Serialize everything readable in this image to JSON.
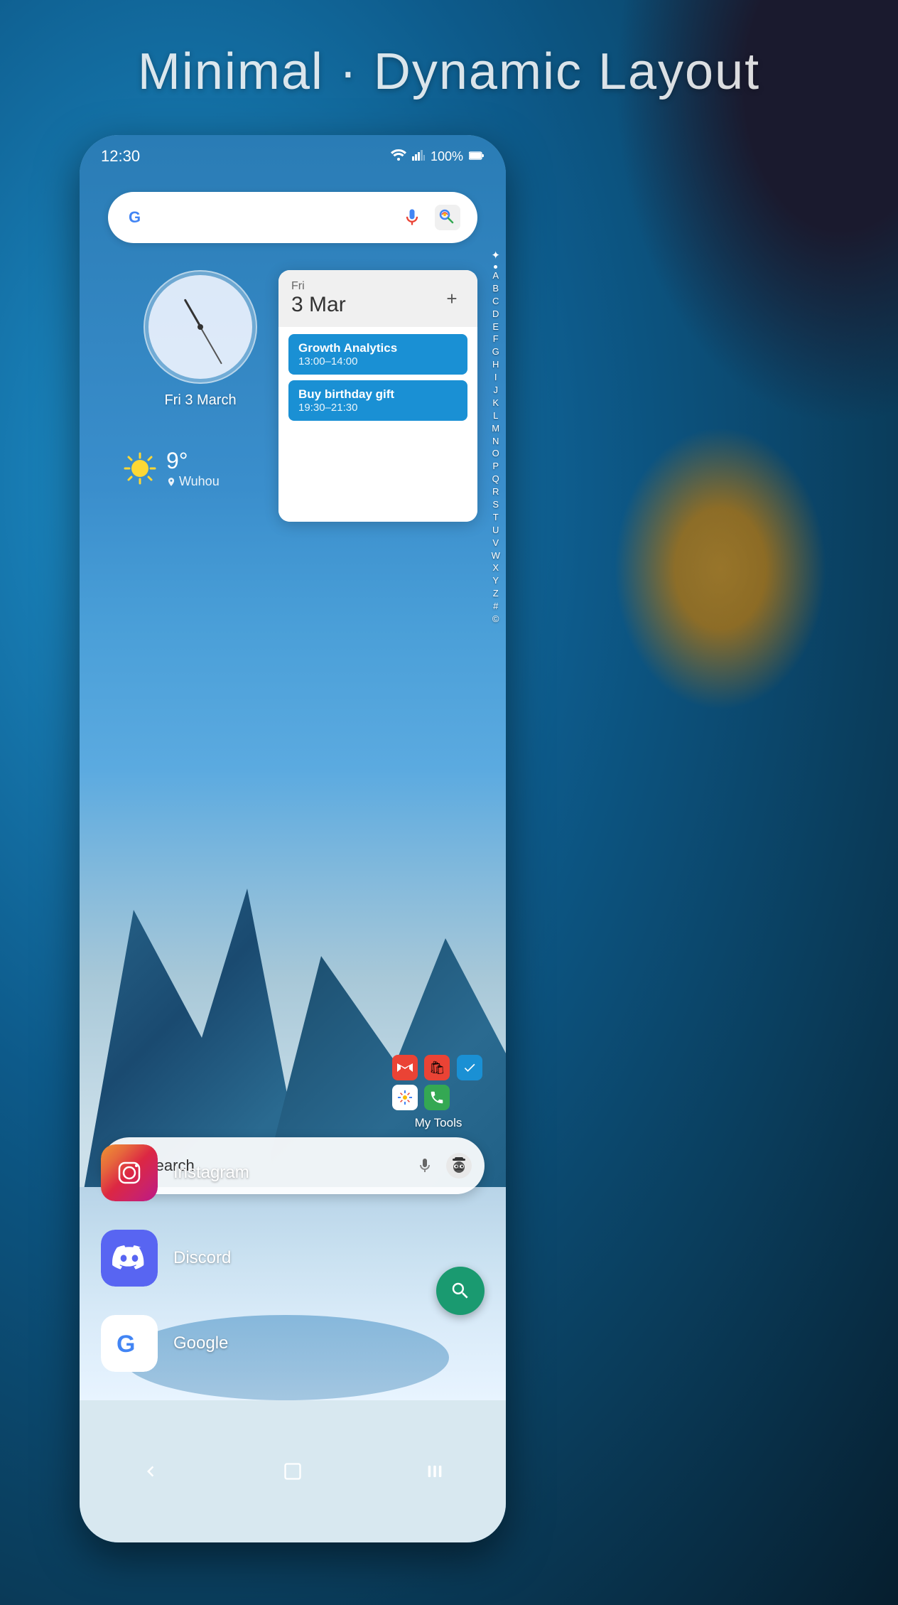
{
  "page": {
    "title": "Minimal · Dynamic Layout",
    "background_colors": {
      "primary": "#1a6fa8",
      "dark": "#0a3d5c",
      "gold": "#d4860a"
    }
  },
  "status_bar": {
    "time": "12:30",
    "battery": "100%",
    "battery_icon": "🔋",
    "wifi_icon": "wifi-icon",
    "signal_icon": "signal-icon"
  },
  "search_bar_top": {
    "placeholder": "",
    "mic_label": "mic-icon",
    "lens_label": "lens-icon"
  },
  "clock": {
    "date": "Fri 3 March",
    "hour_rotation": "-30",
    "minute_rotation": "0"
  },
  "weather": {
    "temperature": "9°",
    "location": "Wuhou",
    "condition": "sunny"
  },
  "calendar": {
    "day_short": "Fri",
    "day_number": "3 Mar",
    "add_button_label": "+",
    "events": [
      {
        "title": "Growth Analytics",
        "time": "13:00–14:00"
      },
      {
        "title": "Buy birthday gift",
        "time": "19:30–21:30"
      }
    ]
  },
  "alphabet_index": {
    "chars": [
      "A",
      "B",
      "C",
      "D",
      "E",
      "F",
      "G",
      "H",
      "I",
      "J",
      "K",
      "L",
      "M",
      "N",
      "O",
      "P",
      "Q",
      "R",
      "S",
      "T",
      "U",
      "V",
      "W",
      "X",
      "Y",
      "Z",
      "#",
      "©"
    ]
  },
  "bottom_search": {
    "text": "Search",
    "mic_label": "mic-icon",
    "spy_label": "incognito-icon"
  },
  "my_tools": {
    "label": "My Tools",
    "icons": [
      {
        "name": "gmail",
        "color": "#EA4335",
        "symbol": "M"
      },
      {
        "name": "shopping",
        "color": "#EA4335",
        "symbol": "🛍"
      },
      {
        "name": "tasks",
        "color": "#1a90d4",
        "symbol": "✓"
      },
      {
        "name": "photos",
        "color": "#fbbc04",
        "symbol": "●"
      },
      {
        "name": "phone",
        "color": "#34a853",
        "symbol": "📞"
      }
    ]
  },
  "apps": [
    {
      "name": "Instagram",
      "icon_type": "instagram"
    },
    {
      "name": "Discord",
      "icon_type": "discord"
    },
    {
      "name": "Google",
      "icon_type": "google"
    }
  ],
  "nav_bar": {
    "back_label": "‹",
    "home_label": "⬜",
    "recents_label": "|||"
  },
  "fab": {
    "icon": "search-icon",
    "label": "🔍"
  }
}
